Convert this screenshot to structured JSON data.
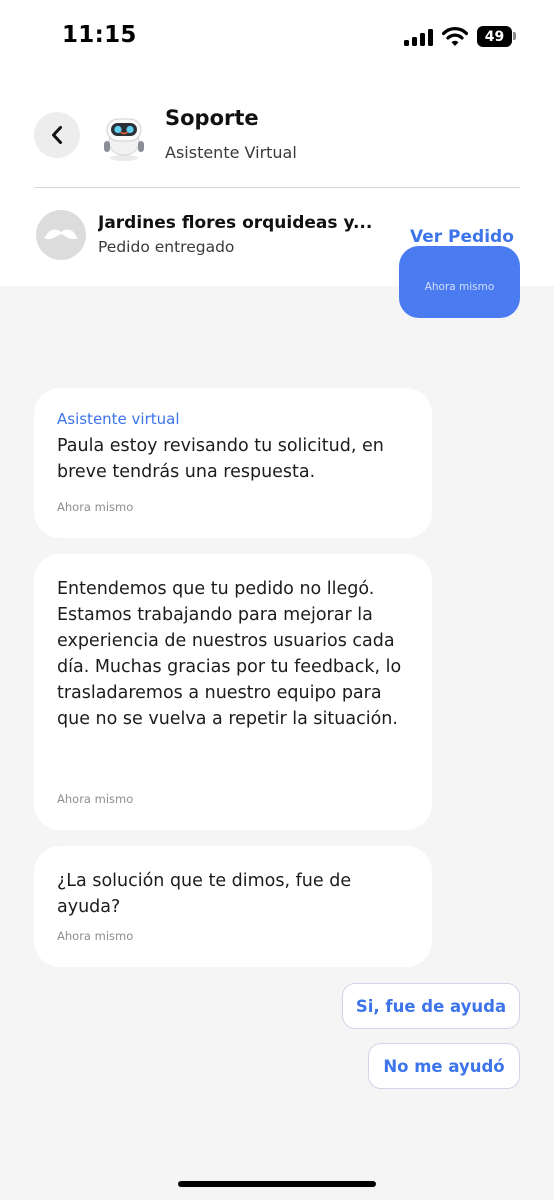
{
  "status_bar": {
    "time": "11:15",
    "battery": "49",
    "icons": [
      "signal-icon",
      "wifi-icon",
      "battery-icon"
    ]
  },
  "header": {
    "back_icon": "chevron-left-icon",
    "agent_avatar": "robot-avatar",
    "agent_name": "Soporte",
    "agent_role": "Asistente Virtual"
  },
  "order": {
    "store_logo": "mustache-logo",
    "title": "Jardines  flores orquideas y...",
    "status": "Pedido entregado",
    "view_label": "Ver Pedido"
  },
  "chat": {
    "user_message": {
      "time": "Ahora mismo"
    },
    "messages": [
      {
        "sender": "Asistente virtual",
        "text": "Paula estoy revisando tu solicitud, en breve tendrás una respuesta.",
        "time": "Ahora mismo"
      },
      {
        "text": "Entendemos que tu pedido no llegó. Estamos trabajando para mejorar la experiencia de nuestros usuarios cada día. Muchas gracias por tu feedback, lo trasladaremos a nuestro equipo para que no se vuelva a repetir la situación.",
        "time": "Ahora mismo"
      },
      {
        "text": "¿La solución que te dimos, fue de ayuda?",
        "time": "Ahora mismo"
      }
    ],
    "quick_replies": [
      "Si, fue de ayuda",
      "No me ayudó"
    ]
  },
  "colors": {
    "accent": "#3d74ea",
    "user_bubble": "#4a7bf0",
    "background": "#f5f5f5"
  }
}
